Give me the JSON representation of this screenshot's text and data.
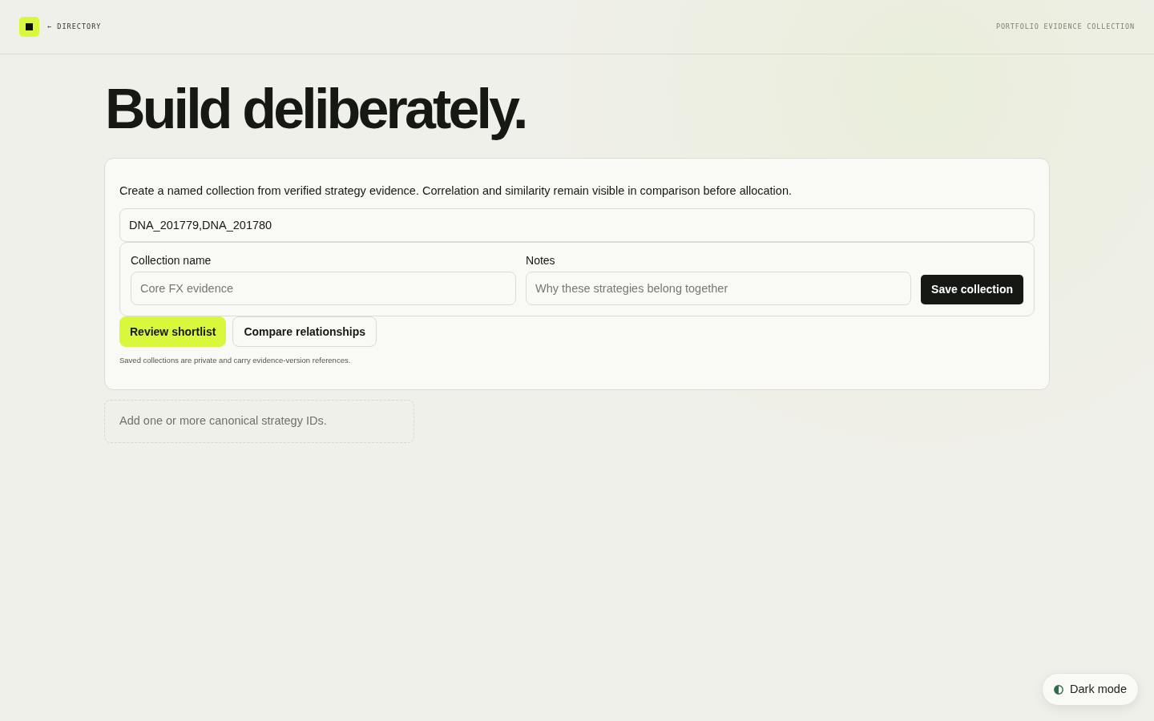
{
  "header": {
    "back_link": "← DIRECTORY",
    "section_label": "PORTFOLIO EVIDENCE COLLECTION"
  },
  "heading": "Build deliberately.",
  "form": {
    "description": "Create a named collection from verified strategy evidence. Correlation and similarity remain visible in comparison before allocation.",
    "ids_field": {
      "value": "DNA_201779,DNA_201780"
    },
    "fields": [
      {
        "label": "Collection name",
        "placeholder": "Core FX evidence"
      },
      {
        "label": "Notes",
        "placeholder": "Why these strategies belong together"
      }
    ],
    "save_button": "Save collection",
    "actions": [
      {
        "label": "Review shortlist",
        "kind": "primary"
      },
      {
        "label": "Compare relationships",
        "kind": "secondary"
      }
    ],
    "footnote": "Saved collections are private and carry evidence-version references."
  },
  "empty_state": "Add one or more canonical strategy IDs.",
  "theme_toggle": {
    "label": "Dark mode"
  }
}
